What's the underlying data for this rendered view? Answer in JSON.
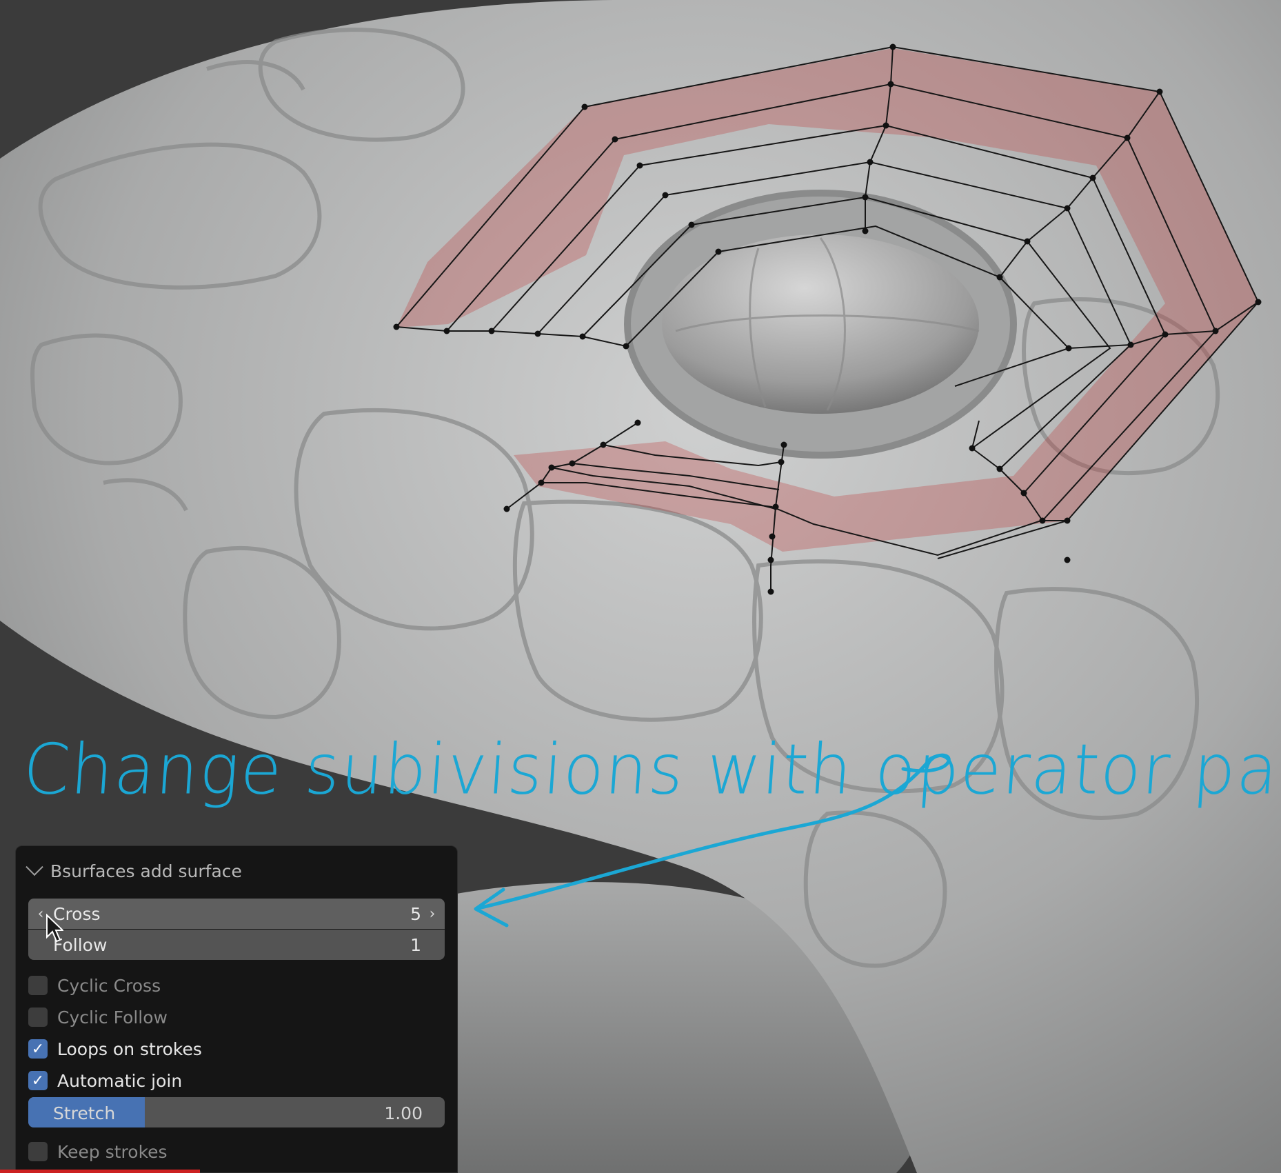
{
  "annotation": {
    "text": "Change subivisions with operator panel"
  },
  "panel": {
    "title": "Bsurfaces add surface",
    "cross": {
      "label": "Cross",
      "value": "5"
    },
    "follow": {
      "label": "Follow",
      "value": "1"
    },
    "checkboxes": [
      {
        "label": "Cyclic Cross",
        "checked": false
      },
      {
        "label": "Cyclic Follow",
        "checked": false
      },
      {
        "label": "Loops on strokes",
        "checked": true
      },
      {
        "label": "Automatic join",
        "checked": true
      }
    ],
    "stretch": {
      "label": "Stretch",
      "value": "1.00",
      "fraction": 0.28
    },
    "keep_strokes": {
      "label": "Keep strokes",
      "checked": false
    }
  },
  "colors": {
    "annotation": "#1ba7d4",
    "accent": "#4772b3",
    "surface_tint": "#c0302f"
  }
}
